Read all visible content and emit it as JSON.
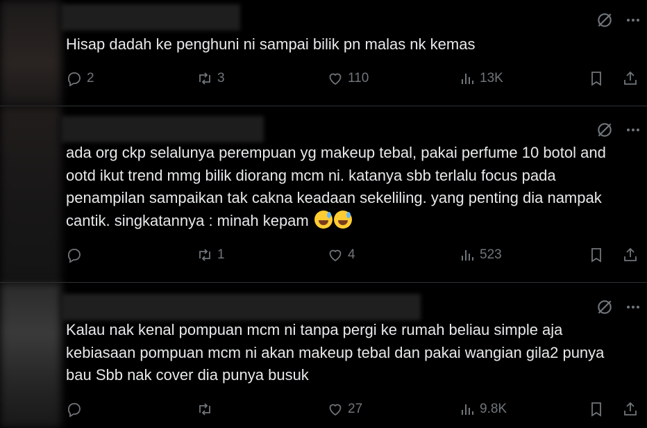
{
  "replies": [
    {
      "text": "Hisap dadah ke penghuni ni sampai bilik pn malas nk kemas",
      "replies_count": "2",
      "reposts": "3",
      "likes": "110",
      "views": "13K"
    },
    {
      "text": "ada org ckp selalunya perempuan yg makeup tebal, pakai perfume 10 botol and ootd ikut trend mmg bilik diorang mcm ni. katanya sbb terlalu focus pada penampilan sampaikan tak cakna keadaan sekeliling. yang penting dia nampak cantik. singkatannya : minah kepam",
      "replies_count": "",
      "reposts": "1",
      "likes": "4",
      "views": "523"
    },
    {
      "text": "Kalau nak kenal pompuan mcm ni tanpa pergi ke rumah beliau simple aja kebiasaan pompuan mcm ni akan makeup tebal dan pakai wangian gila2 punya bau Sbb nak cover dia punya busuk",
      "replies_count": "",
      "reposts": "",
      "likes": "27",
      "views": "9.8K"
    }
  ],
  "icons": {
    "reply": "reply-icon",
    "repost": "repost-icon",
    "like": "heart-icon",
    "views": "views-icon",
    "bookmark": "bookmark-icon",
    "share": "share-icon",
    "grok": "grok-icon",
    "more": "more-icon"
  },
  "colors": {
    "background": "#000000",
    "text": "#e7e9ea",
    "muted": "#71767b",
    "divider": "#2f3336"
  }
}
